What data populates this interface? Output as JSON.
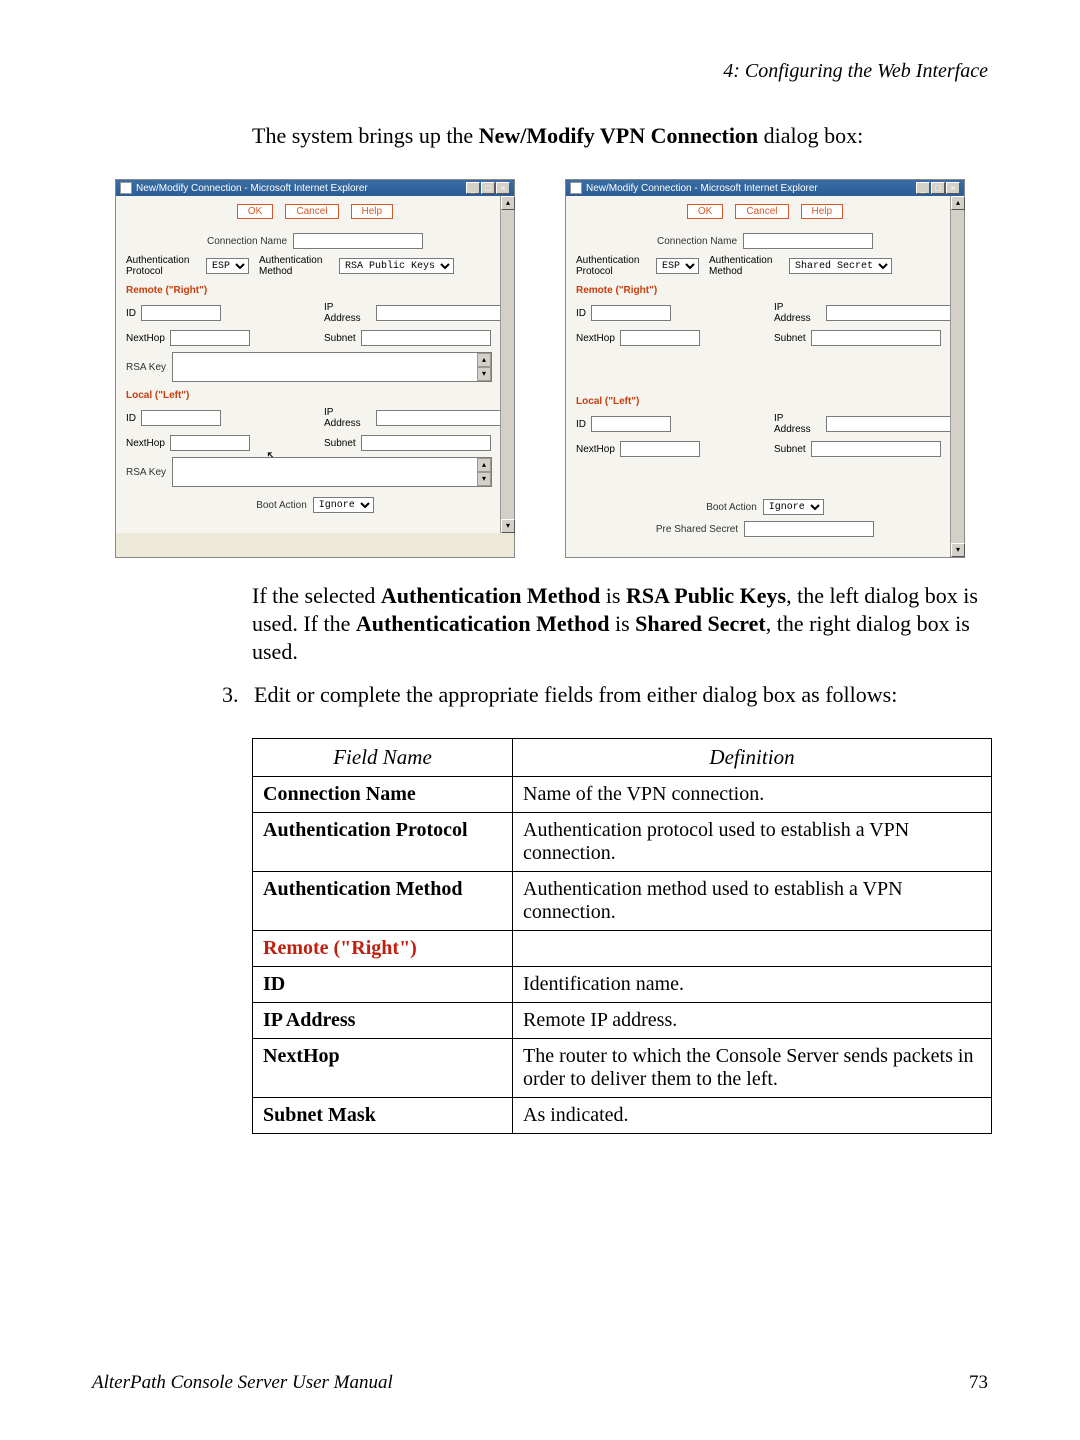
{
  "header": {
    "chapter": "4: Configuring the Web Interface"
  },
  "intro": {
    "prefix": "The system brings up the ",
    "bold": "New/Modify VPN Connection",
    "suffix": " dialog box:"
  },
  "dialog_common": {
    "title": "New/Modify Connection - Microsoft Internet Explorer",
    "buttons": {
      "ok": "OK",
      "cancel": "Cancel",
      "help": "Help"
    },
    "conn_name_label": "Connection Name",
    "auth_protocol_label": "Authentication Protocol",
    "auth_protocol_value": "ESP",
    "auth_method_label": "Authentication Method",
    "remote_header": "Remote (\"Right\")",
    "local_header": "Local (\"Left\")",
    "id_label": "ID",
    "ip_label": "IP Address",
    "nexthop_label": "NextHop",
    "subnet_label": "Subnet",
    "rsa_key_label": "RSA Key",
    "boot_action_label": "Boot Action",
    "boot_action_value": "Ignore",
    "pre_shared_label": "Pre Shared Secret"
  },
  "dialog_left": {
    "auth_method_value": "RSA Public Keys"
  },
  "dialog_right": {
    "auth_method_value": "Shared Secret"
  },
  "explanation": {
    "p1a": "If the selected ",
    "p1b": "Authentication Method",
    "p1c": " is ",
    "p1d": "RSA Public Keys",
    "p1e": ", the left dialog box is used. If the ",
    "p1f": "Authenticatication Method",
    "p1g": " is ",
    "p1h": "Shared Secret",
    "p1i": ", the right dialog box is used."
  },
  "step": {
    "num": "3.",
    "text": "Edit or complete the appropriate fields from either dialog box as follows:"
  },
  "table": {
    "head": {
      "c1": "Field Name",
      "c2": "Definition"
    },
    "rows": [
      {
        "f": "Connection Name",
        "d": "Name of the VPN connection.",
        "red": false
      },
      {
        "f": "Authentication Protocol",
        "d": "Authentication protocol used to establish a VPN connection.",
        "red": false
      },
      {
        "f": "Authentication Method",
        "d": "Authentication method used to establish a VPN connection.",
        "red": false
      },
      {
        "f": "Remote (\"Right\")",
        "d": "",
        "red": true
      },
      {
        "f": "ID",
        "d": "Identification name.",
        "red": false
      },
      {
        "f": "IP Address",
        "d": "Remote IP address.",
        "red": false
      },
      {
        "f": "NextHop",
        "d": "The router to which the Console Server sends packets in order to deliver them to the left.",
        "red": false
      },
      {
        "f": "Subnet Mask",
        "d": "As indicated.",
        "red": false
      }
    ]
  },
  "footer": {
    "left": "AlterPath Console Server User Manual",
    "right": "73"
  }
}
